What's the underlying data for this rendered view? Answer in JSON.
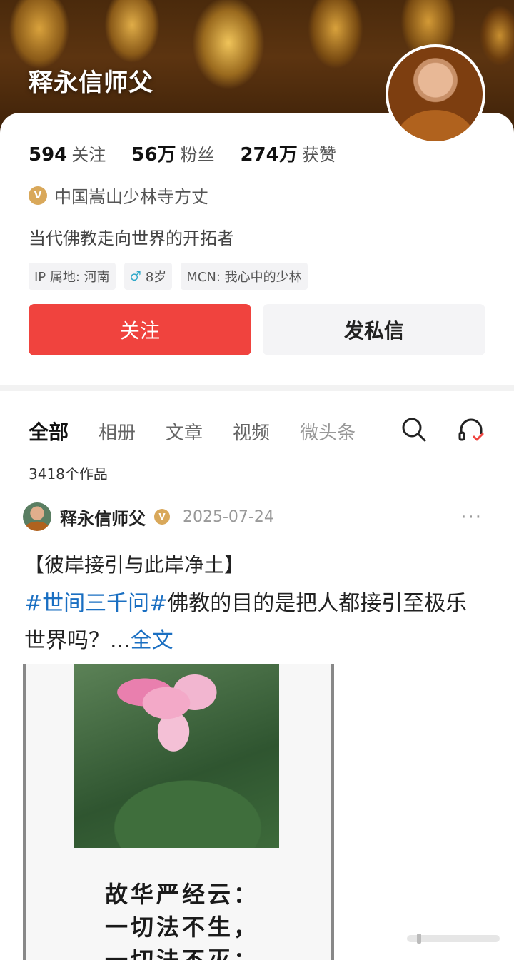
{
  "profile": {
    "name": "释永信师父",
    "stats": [
      {
        "num": "594",
        "label": "关注"
      },
      {
        "num": "56万",
        "label": "粉丝"
      },
      {
        "num": "274万",
        "label": "获赞"
      }
    ],
    "verify_badge": "V",
    "verify_text": "中国嵩山少林寺方丈",
    "bio": "当代佛教走向世界的开拓者",
    "tags": {
      "ip": "IP 属地: 河南",
      "age": "8岁",
      "mcn": "MCN: 我心中的少林"
    },
    "follow_label": "关注",
    "message_label": "发私信"
  },
  "tabs": [
    "全部",
    "相册",
    "文章",
    "视频",
    "微头条"
  ],
  "works_count": "3418个作品",
  "post": {
    "author": "释永信师父",
    "badge": "V",
    "date": "2025-07-24",
    "more": "···",
    "title": "【彼岸接引与此岸净土】",
    "hashtag": "#世间三千问#",
    "body": "佛教的目的是把人都接引至极乐世界吗？...",
    "read_more": "全文",
    "image_text": [
      "故华严经云：",
      "一切法不生，",
      "一切法不灭："
    ]
  }
}
